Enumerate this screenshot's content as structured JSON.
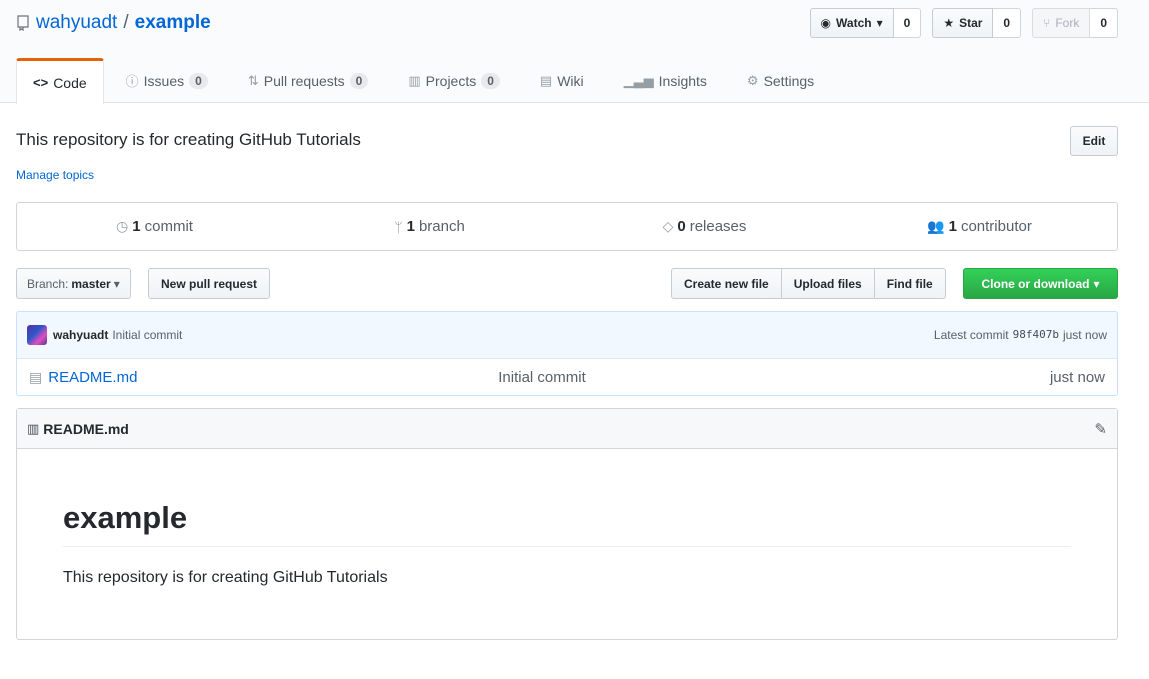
{
  "repo": {
    "owner": "wahyuadt",
    "separator": "/",
    "name": "example"
  },
  "actions": {
    "watch": {
      "label": "Watch",
      "count": "0"
    },
    "star": {
      "label": "Star",
      "count": "0"
    },
    "fork": {
      "label": "Fork",
      "count": "0"
    }
  },
  "tabs": [
    {
      "label": "Code",
      "icon": "code-icon",
      "selected": true
    },
    {
      "label": "Issues",
      "counter": "0",
      "icon": "issue-icon"
    },
    {
      "label": "Pull requests",
      "counter": "0",
      "icon": "pull-request-icon"
    },
    {
      "label": "Projects",
      "counter": "0",
      "icon": "project-icon"
    },
    {
      "label": "Wiki",
      "icon": "book-icon"
    },
    {
      "label": "Insights",
      "icon": "graph-icon"
    },
    {
      "label": "Settings",
      "icon": "gear-icon"
    }
  ],
  "description": "This repository is for creating GitHub Tutorials",
  "edit_label": "Edit",
  "manage_topics": "Manage topics",
  "summary": {
    "commits": {
      "num": "1",
      "label": "commit"
    },
    "branches": {
      "num": "1",
      "label": "branch"
    },
    "releases": {
      "num": "0",
      "label": "releases"
    },
    "contributors": {
      "num": "1",
      "label": "contributor"
    }
  },
  "file_nav": {
    "branch_prefix": "Branch:",
    "branch_name": "master",
    "new_pr": "New pull request",
    "create_file": "Create new file",
    "upload_files": "Upload files",
    "find_file": "Find file",
    "clone": "Clone or download"
  },
  "commit": {
    "author": "wahyuadt",
    "message": "Initial commit",
    "latest_label": "Latest commit",
    "sha": "98f407b",
    "age": "just now"
  },
  "files": [
    {
      "name": "README.md",
      "message": "Initial commit",
      "age": "just now"
    }
  ],
  "readme": {
    "filename": "README.md",
    "heading": "example",
    "body": "This repository is for creating GitHub Tutorials"
  },
  "colors": {
    "accent": "#0366d6",
    "tab_active": "#e36209",
    "clone_green": "#28a745"
  }
}
